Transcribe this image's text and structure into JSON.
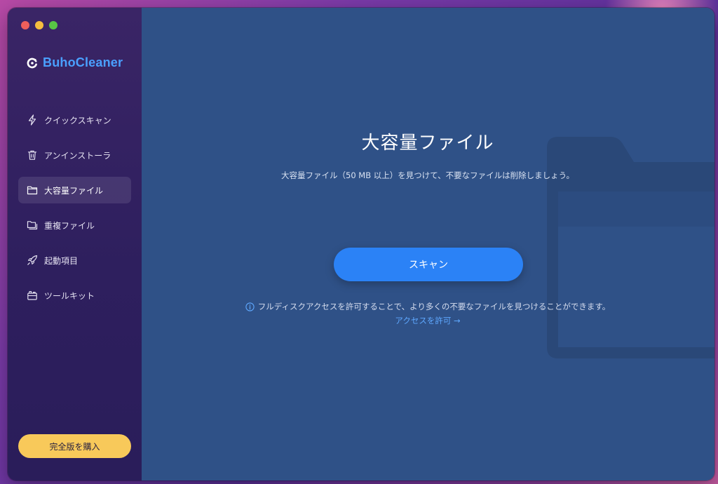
{
  "app": {
    "name": "BuhoCleaner"
  },
  "sidebar": {
    "items": [
      {
        "label": "クイックスキャン",
        "icon": "lightning-icon",
        "active": false
      },
      {
        "label": "アンインストーラ",
        "icon": "trash-icon",
        "active": false
      },
      {
        "label": "大容量ファイル",
        "icon": "folder-icon",
        "active": true
      },
      {
        "label": "重複ファイル",
        "icon": "duplicate-folder-icon",
        "active": false
      },
      {
        "label": "起動項目",
        "icon": "rocket-icon",
        "active": false
      },
      {
        "label": "ツールキット",
        "icon": "toolkit-icon",
        "active": false
      }
    ],
    "buy_label": "完全版を購入"
  },
  "main": {
    "title": "大容量ファイル",
    "subtitle": "大容量ファイル（50 MB 以上）を見つけて、不要なファイルは削除しましょう。",
    "scan_label": "スキャン",
    "notice": "フルディスクアクセスを許可することで、より多くの不要なファイルを見つけることができます。",
    "access_link": "アクセスを許可 →"
  },
  "colors": {
    "brand": "#4aa0ff",
    "main_bg": "#2f5187",
    "scan_button": "#2b82f6",
    "buy_button": "#f8c95a",
    "link": "#5ea8ff"
  }
}
